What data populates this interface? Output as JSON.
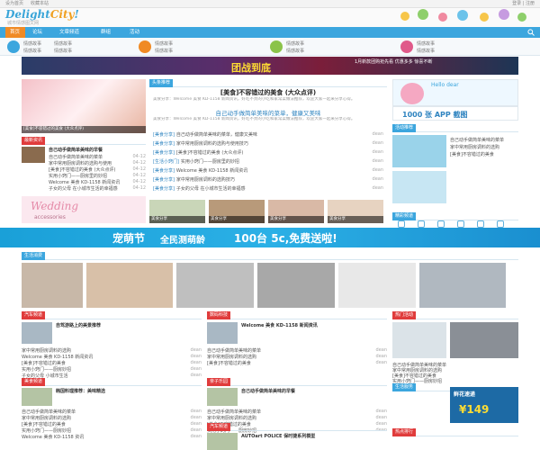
{
  "topbar": {
    "left": [
      "设为首页",
      "收藏本站"
    ],
    "right": "登录 | 注册"
  },
  "logo": {
    "main": "Delight",
    "accent": "City",
    "suffix": "!",
    "sub": "城市情感图文网"
  },
  "nav": {
    "home": "首页",
    "items": [
      "论坛",
      "文章频道",
      "群组",
      "活动"
    ]
  },
  "subnav_links": [
    "情感故事",
    "情感故事",
    "情感故事",
    "情感故事",
    "情感故事",
    "情感故事",
    "情感故事",
    "情感故事",
    "情感故事",
    "情感故事"
  ],
  "banner": {
    "main": "团战到底",
    "side": "1月新款团购抢先看 优惠多多 惊喜不断"
  },
  "headline": {
    "section": "头条推荐",
    "title": "[美食]不容错过的美食 (大众点评)",
    "subtitle": "自己动手做简单美味的菜单，健康又美味",
    "summary": "美食分享：Welcome 美食 KD-1158 新闻资讯，好吃不贵的小吃和家常菜做法推荐，欢迎大家一起来分享心得。"
  },
  "news_rows": [
    {
      "cat": "[美食分享]",
      "title": "自己动手做简单美味的菜单，健康又美味",
      "date": "dean"
    },
    {
      "cat": "[美食分享]",
      "title": "家中常用厨房调料的选购与使用技巧",
      "date": "dean"
    },
    {
      "cat": "[美食分享]",
      "title": "[美食]不容错过的美食 (大众点评)",
      "date": "dean"
    },
    {
      "cat": "[生活小窍门]",
      "title": "实用小窍门——厨房里的妙招",
      "date": "dean"
    },
    {
      "cat": "[美食分享]",
      "title": "Welcome 美食 KD-1158 新闻资讯",
      "date": "dean"
    },
    {
      "cat": "[美食分享]",
      "title": "家中常用厨房调料的选购技巧",
      "date": "dean"
    },
    {
      "cat": "[美食分享]",
      "title": "子女的父母 在小城市生活的幸福感",
      "date": "dean"
    }
  ],
  "left_col": {
    "section": "最新资讯",
    "feature": "自己动手做简单美味的早餐",
    "rows": [
      {
        "title": "自己动手做简单美味的菜单",
        "date": "04-12"
      },
      {
        "title": "家中常用厨房调料的选购与使用",
        "date": "04-12"
      },
      {
        "title": "[美食]不容错过的美食 (大众点评)",
        "date": "04-12"
      },
      {
        "title": "实用小窍门——厨房里的妙招",
        "date": "04-12"
      },
      {
        "title": "Welcome 美食 KD-1158 新闻资讯",
        "date": "04-12"
      },
      {
        "title": "子女的父母 在小城市生活的幸福感",
        "date": "04-12"
      }
    ],
    "wedding": "Wedding",
    "wedding_sub": "accessories"
  },
  "photo_strip": [
    "美食分享",
    "美食分享",
    "美食分享",
    "美食分享"
  ],
  "wide_ad": {
    "a": "宠萌节",
    "b": "全民测萌龄",
    "c": "100台 5c,免费送啦!"
  },
  "life_section": {
    "label": "生活消费"
  },
  "bottom_sections": [
    {
      "label": "美食频道",
      "title": "韩国料理推荐：美味精选",
      "rows": [
        "自己动手做简单美味的菜单",
        "家中常用厨房调料的选购",
        "[美食]不容错过的美食",
        "实用小窍门——厨房妙招",
        "Welcome 美食 KD-1158 资讯"
      ]
    },
    {
      "label": "亲子乐园",
      "title": "自己动手做简单美味的早餐",
      "rows": [
        "自己动手做简单美味的菜单",
        "家中常用厨房调料的选购",
        "[美食]不容错过的美食",
        "实用小窍门——厨房妙招"
      ]
    },
    {
      "label": "汽车频道",
      "title": "AUTOart POLICE 保时捷系列模型",
      "rows": [
        "自己动手做简单美味的菜单",
        "家中常用厨房调料的选购"
      ]
    }
  ],
  "mid_sections": [
    {
      "label": "汽车频道",
      "title": "自驾游路上的美景推荐",
      "rows": [
        "家中常用厨房调料的选购",
        "Welcome 美食 KD-1158 新闻资讯",
        "[美食]不容错过的美食",
        "实用小窍门——厨房妙招",
        "子女的父母 小城市生活"
      ]
    },
    {
      "label": "数码科技",
      "title": "Welcome 美食 KD-1158 新闻资讯",
      "rows": [
        "自己动手做简单美味的菜单",
        "家中常用厨房调料的选购",
        "[美食]不容错过的美食"
      ]
    }
  ],
  "sidebar": {
    "hello": "Hello dear",
    "app_ad": "1000 张 APP 截图",
    "section1": "活动推荐",
    "rows1": [
      "自己动手做简单美味的菜单",
      "家中常用厨房调料的选购",
      "[美食]不容错过的美食"
    ],
    "section2": "精彩频道",
    "section3": "热门活动",
    "rows3": [
      "自己动手做简单美味的菜单",
      "家中常用厨房调料的选购",
      "[美食]不容错过的美食",
      "实用小窍门——厨房妙招"
    ],
    "section4": "生活服务",
    "flower_ad": "鲜花速递",
    "flower_price": "¥149",
    "section5": "热点排行"
  },
  "date_label": "dean"
}
